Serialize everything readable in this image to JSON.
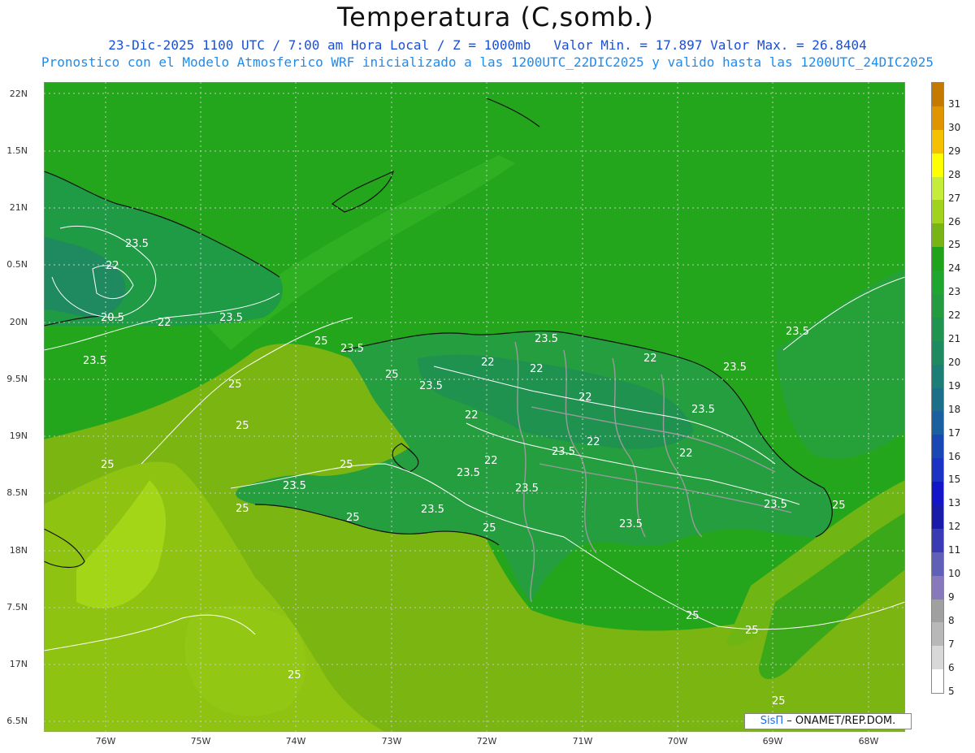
{
  "header": {
    "title": "Temperatura (C,somb.)",
    "line1_date": "23-Dic-2025  1100 UTC / 7:00 am Hora Local / Z = 1000mb",
    "line1_minmax": "Valor Min. = 17.897  Valor Max. = 26.8404",
    "line2": "Pronostico con el Modelo Atmosferico WRF inicializado a las 1200UTC_22DIC2025 y valido hasta las  1200UTC_24DIC2025"
  },
  "axes": {
    "lat_labels": [
      "22N",
      "1.5N",
      "21N",
      "0.5N",
      "20N",
      "9.5N",
      "19N",
      "8.5N",
      "18N",
      "7.5N",
      "17N",
      "6.5N"
    ],
    "lon_labels": [
      "76W",
      "75W",
      "74W",
      "73W",
      "72W",
      "71W",
      "70W",
      "69W",
      "68W"
    ]
  },
  "colorbar": {
    "labels": [
      "31",
      "30",
      "29",
      "28",
      "27",
      "26",
      "25",
      "24",
      "23",
      "22",
      "21",
      "20",
      "19",
      "18",
      "17",
      "16",
      "15",
      "13",
      "12",
      "11",
      "10",
      "9",
      "8",
      "7",
      "6",
      "5"
    ],
    "colors": [
      "#c47a00",
      "#e09400",
      "#f5c000",
      "#ffff00",
      "#c6ec3a",
      "#a0d21e",
      "#78b414",
      "#1fa31a",
      "#1fa62e",
      "#229c3f",
      "#1f9450",
      "#1e8a60",
      "#1c7e74",
      "#1b6f88",
      "#1a5fa0",
      "#1948b4",
      "#1a33c4",
      "#1414c8",
      "#1a1aaa",
      "#3a3ab4",
      "#6060b8",
      "#8878bc",
      "#a0a0a0",
      "#b8b8b8",
      "#d8d8d8",
      "#ffffff"
    ]
  },
  "contour_labels": [
    {
      "text": "23.5"
    },
    {
      "text": "22"
    },
    {
      "text": "20.5"
    },
    {
      "text": "22"
    },
    {
      "text": "23.5"
    },
    {
      "text": "23.5"
    },
    {
      "text": "25"
    },
    {
      "text": "23.5"
    },
    {
      "text": "25"
    },
    {
      "text": "25"
    },
    {
      "text": "25"
    },
    {
      "text": "23.5"
    },
    {
      "text": "22"
    },
    {
      "text": "23.5"
    },
    {
      "text": "22"
    },
    {
      "text": "22"
    },
    {
      "text": "22"
    },
    {
      "text": "22"
    },
    {
      "text": "23.5"
    },
    {
      "text": "23.5"
    },
    {
      "text": "23.5"
    },
    {
      "text": "22"
    },
    {
      "text": "22"
    },
    {
      "text": "23.5"
    },
    {
      "text": "22"
    },
    {
      "text": "23.5"
    },
    {
      "text": "23.5"
    },
    {
      "text": "25"
    },
    {
      "text": "23.5"
    },
    {
      "text": "25"
    },
    {
      "text": "23.5"
    },
    {
      "text": "25"
    },
    {
      "text": "25"
    },
    {
      "text": "25"
    },
    {
      "text": "23.5"
    },
    {
      "text": "25"
    },
    {
      "text": "25"
    },
    {
      "text": "25"
    },
    {
      "text": "25"
    },
    {
      "text": "25"
    },
    {
      "text": "23.5"
    }
  ],
  "credit": {
    "sis": "SisΠ",
    "rest": "– ONAMET/REP.DOM."
  }
}
